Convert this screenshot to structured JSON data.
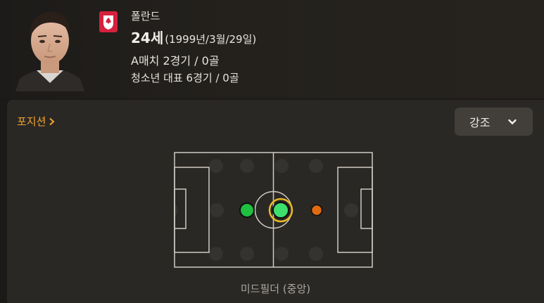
{
  "player": {
    "nationality": "폴란드",
    "age": "24세",
    "dob": "(1999년/3월/29일)",
    "a_caps": "A매치 2경기 / 0골",
    "youth_caps": "청소년 대표 6경기 / 0골"
  },
  "positions": {
    "link_label": "포지션",
    "highlight_button": "강조",
    "position_name": "미드필더 (중앙)"
  },
  "pitch": {
    "markers": [
      {
        "role": "primary",
        "color": "#3ee06d",
        "ring": "#e8b923"
      },
      {
        "role": "secondary",
        "color": "#1fbf3f"
      },
      {
        "role": "tertiary",
        "color": "#e06a10"
      }
    ],
    "line_color": "#cfcbc4",
    "placeholder_color": "#3a3835"
  },
  "colors": {
    "accent": "#f0a431",
    "panel": "#2a2825"
  }
}
